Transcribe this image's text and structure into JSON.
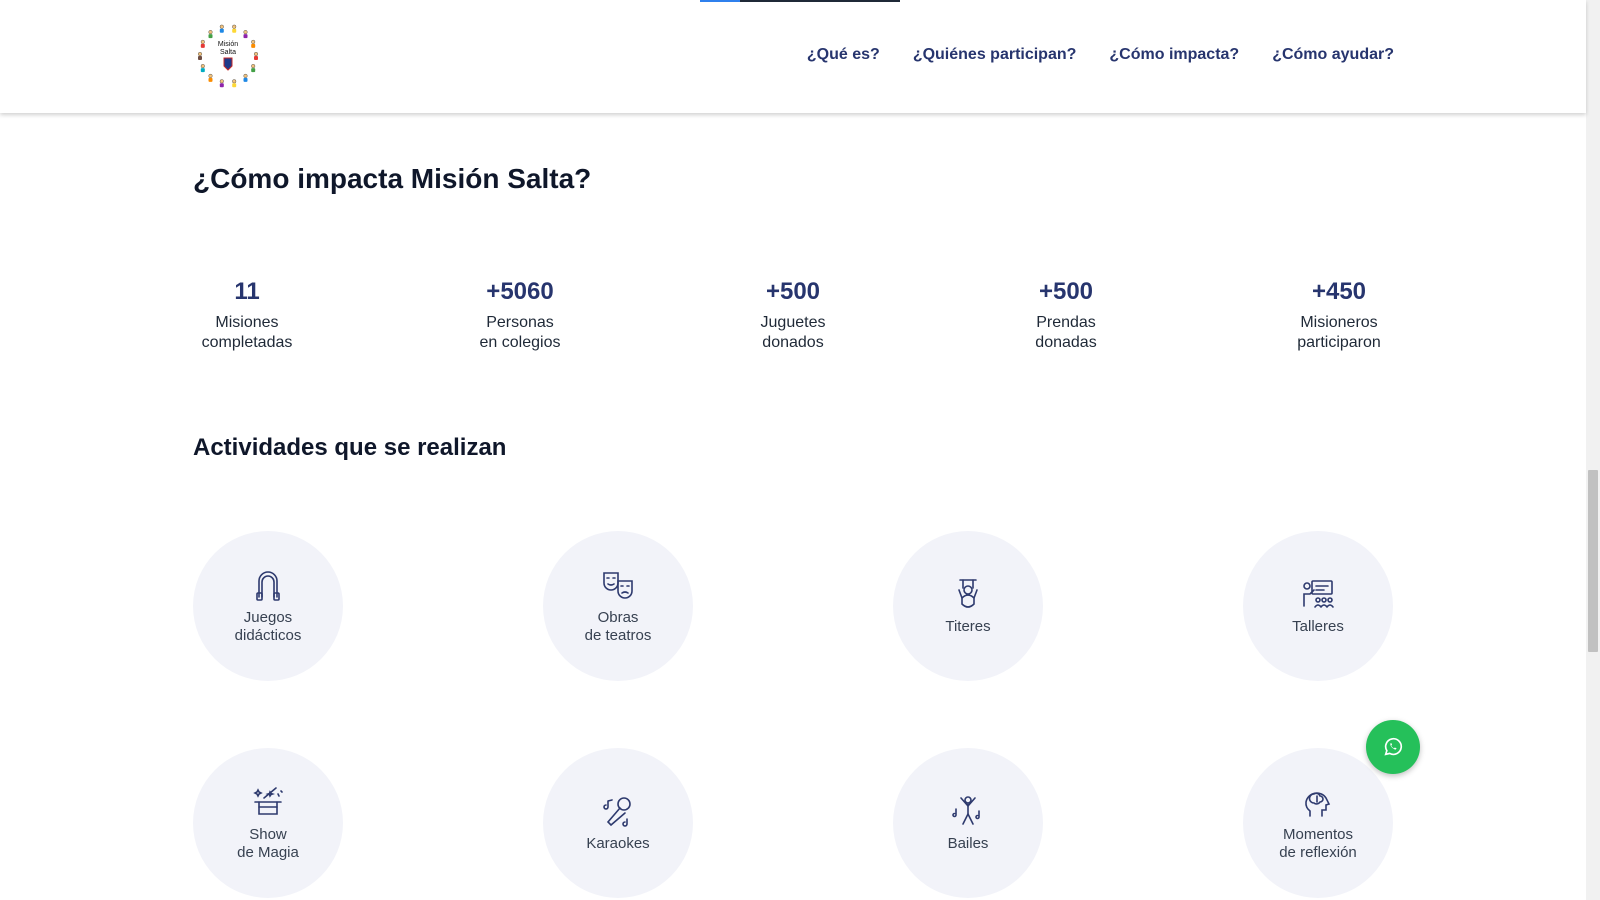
{
  "header": {
    "logo_text": "Misión Salta",
    "scroll_progress": 0.2,
    "nav": [
      {
        "label": "¿Qué es?"
      },
      {
        "label": "¿Quiénes participan?"
      },
      {
        "label": "¿Cómo impacta?"
      },
      {
        "label": "¿Cómo ayudar?"
      }
    ]
  },
  "impact": {
    "title": "¿Cómo impacta Misión Salta?",
    "stats": [
      {
        "value": "11",
        "label": "Misiones\ncompletadas"
      },
      {
        "value": "+5060",
        "label": "Personas\nen colegios"
      },
      {
        "value": "+500",
        "label": "Juguetes\ndonados"
      },
      {
        "value": "+500",
        "label": "Prendas\ndonadas"
      },
      {
        "value": "+450",
        "label": "Misioneros\nparticiparon"
      }
    ]
  },
  "activities": {
    "title": "Actividades que se realizan",
    "items": [
      {
        "label": "Juegos\ndidácticos",
        "icon": "jump-rope-icon"
      },
      {
        "label": "Obras\nde teatros",
        "icon": "theater-masks-icon"
      },
      {
        "label": "Titeres",
        "icon": "puppet-icon"
      },
      {
        "label": "Talleres",
        "icon": "classroom-icon"
      },
      {
        "label": "Show\nde Magia",
        "icon": "magic-hat-icon"
      },
      {
        "label": "Karaokes",
        "icon": "microphone-icon"
      },
      {
        "label": "Bailes",
        "icon": "dancer-icon"
      },
      {
        "label": "Momentos\nde reflexión",
        "icon": "head-thought-icon"
      }
    ]
  },
  "whatsapp": {
    "icon": "whatsapp-icon"
  },
  "colors": {
    "nav_text": "#27356e",
    "stat_value": "#27356e",
    "circle_bg": "#f2f3f9",
    "whatsapp_green": "#25c05a",
    "progress": "#2f80ed"
  }
}
